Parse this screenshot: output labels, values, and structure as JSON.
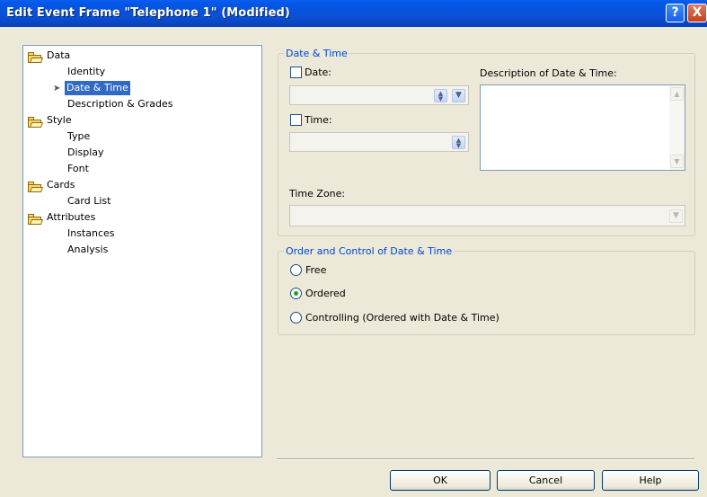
{
  "window": {
    "title": "Edit Event Frame \"Telephone 1\" (Modified)",
    "help_btn": "?",
    "close_btn": "X"
  },
  "tree": {
    "data": "Data",
    "identity": "Identity",
    "date_time": "Date & Time",
    "desc_grades": "Description & Grades",
    "style": "Style",
    "type": "Type",
    "display": "Display",
    "font": "Font",
    "cards": "Cards",
    "card_list": "Card List",
    "attributes": "Attributes",
    "instances": "Instances",
    "analysis": "Analysis"
  },
  "date_time_group": {
    "legend": "Date & Time",
    "date_label": "Date:",
    "date_checked": false,
    "date_value": "",
    "time_label": "Time:",
    "time_checked": false,
    "time_value": "",
    "description_label": "Description of Date & Time:",
    "description_value": "",
    "timezone_label": "Time Zone:",
    "timezone_value": ""
  },
  "order_group": {
    "legend": "Order and Control of Date & Time",
    "options": [
      {
        "label": "Free",
        "selected": false
      },
      {
        "label": "Ordered",
        "selected": true
      },
      {
        "label": "Controlling (Ordered with Date & Time)",
        "selected": false
      }
    ]
  },
  "buttons": {
    "ok": "OK",
    "cancel": "Cancel",
    "help": "Help"
  },
  "colors": {
    "titlebar": "#0a5ef0",
    "selection": "#316ac5",
    "group_legend": "#0046d5",
    "radio_dot": "#21a121"
  }
}
